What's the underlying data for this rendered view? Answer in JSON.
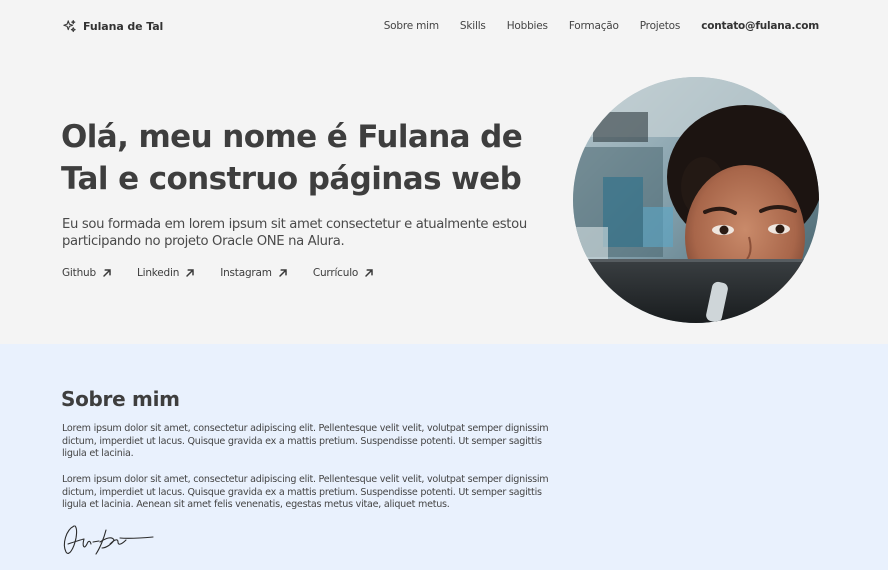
{
  "header": {
    "brand": "Fulana de Tal",
    "brand_icon": "sparkles-icon",
    "nav": [
      {
        "label": "Sobre mim"
      },
      {
        "label": "Skills"
      },
      {
        "label": "Hobbies"
      },
      {
        "label": "Formação"
      },
      {
        "label": "Projetos"
      },
      {
        "label": "contato@fulana.com"
      }
    ]
  },
  "hero": {
    "title": "Olá, meu nome é Fulana de Tal e construo páginas web",
    "description": "Eu sou formada em lorem ipsum sit amet consectetur e atualmente estou participando no projeto Oracle ONE na Alura.",
    "links": [
      {
        "label": "Github",
        "icon": "arrow-up-right-icon"
      },
      {
        "label": "Linkedin",
        "icon": "arrow-up-right-icon"
      },
      {
        "label": "Instagram",
        "icon": "arrow-up-right-icon"
      },
      {
        "label": "Currículo",
        "icon": "arrow-up-right-icon"
      }
    ]
  },
  "about": {
    "title": "Sobre mim",
    "paragraphs": [
      "Lorem ipsum dolor sit amet, consectetur adipiscing elit. Pellentesque velit velit, volutpat semper dignissim dictum, imperdiet ut lacus. Quisque gravida ex a mattis pretium. Suspendisse potenti. Ut semper sagittis ligula et lacinia.",
      "Lorem ipsum dolor sit amet, consectetur adipiscing elit. Pellentesque velit velit, volutpat semper dignissim dictum, imperdiet ut lacus. Quisque gravida ex a mattis pretium. Suspendisse potenti. Ut semper sagittis ligula et lacinia. Aenean sit amet felis venenatis, egestas metus vitae, aliquet metus."
    ]
  },
  "colors": {
    "page_bg": "#f4f4f4",
    "about_bg": "#e9f1fd",
    "text": "#3e3e3e"
  }
}
